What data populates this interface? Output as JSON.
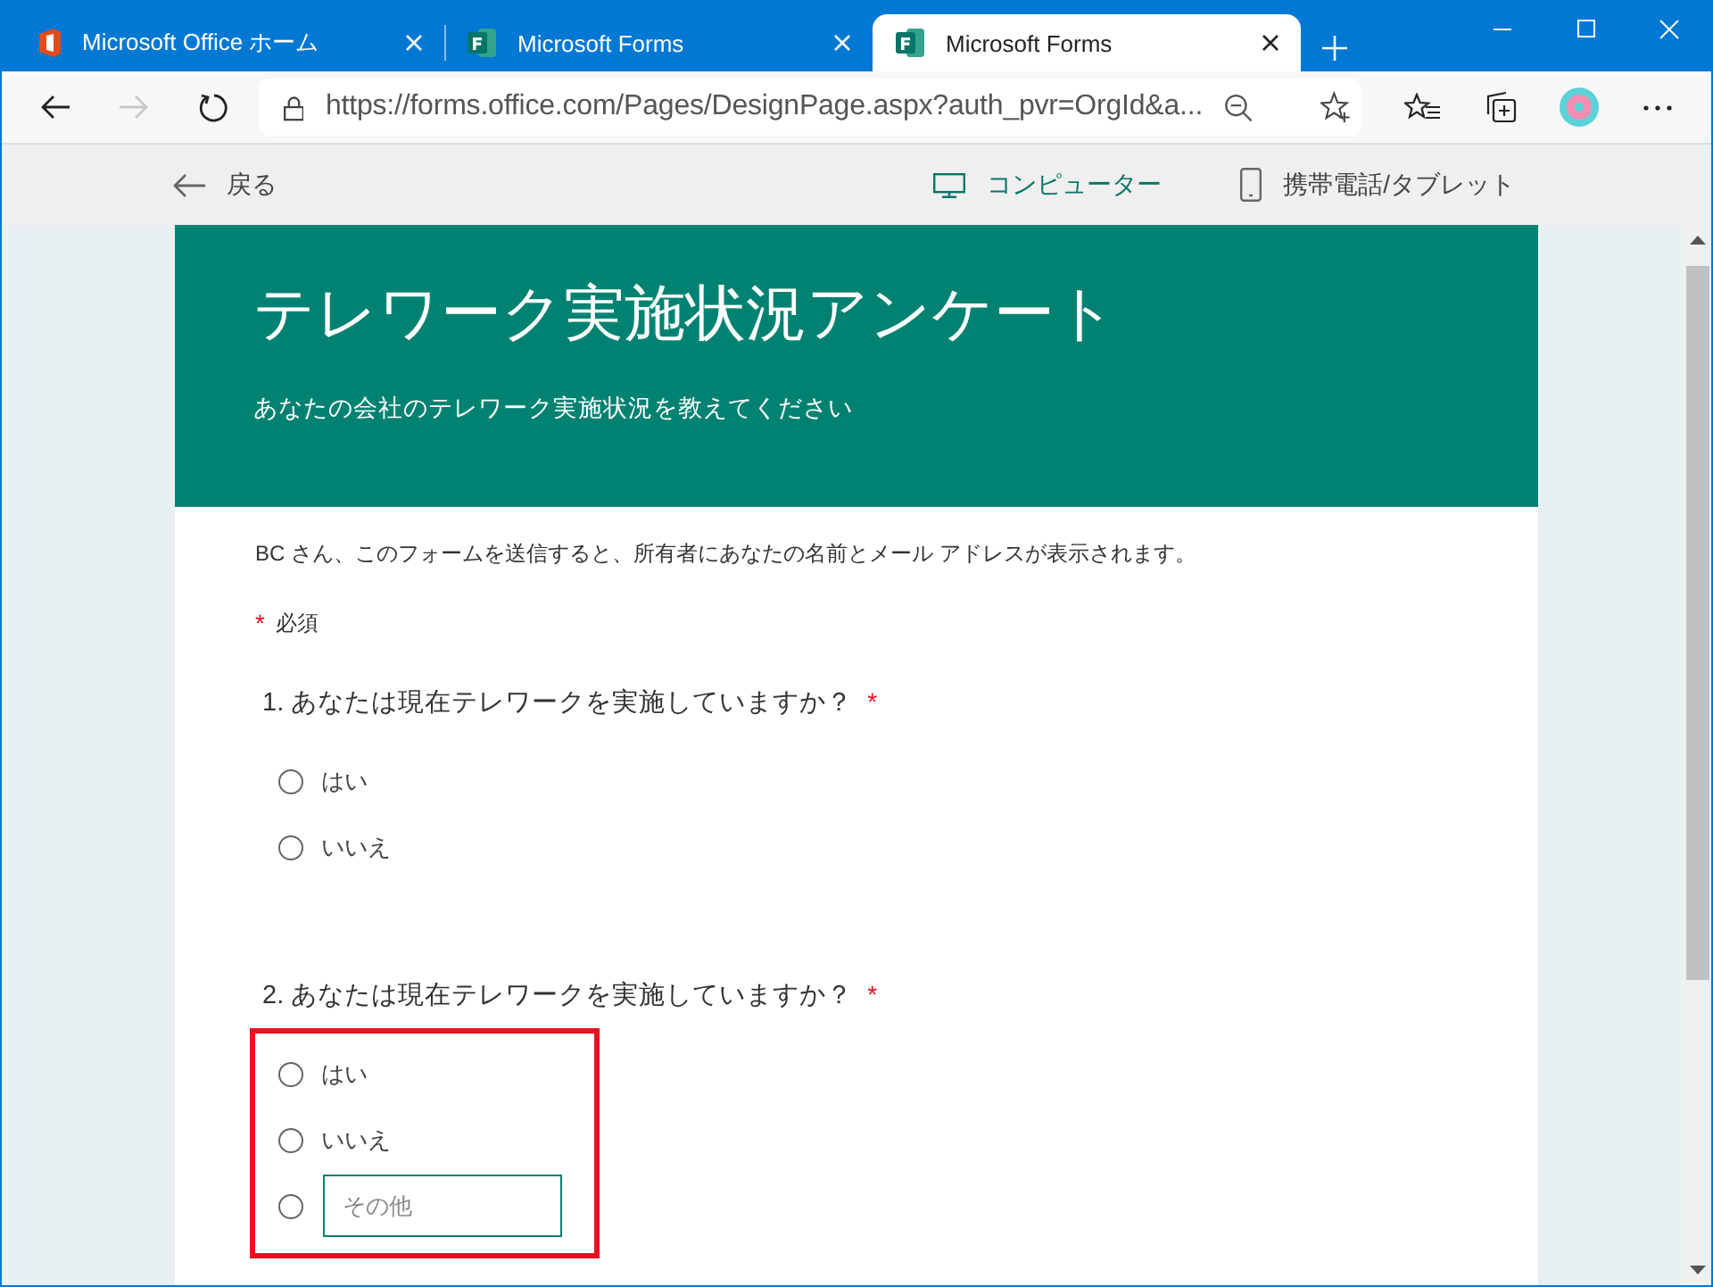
{
  "browser": {
    "tabs": [
      {
        "title": "Microsoft Office ホーム",
        "kind": "office",
        "selected": false
      },
      {
        "title": "Microsoft Forms",
        "kind": "forms",
        "selected": false
      },
      {
        "title": "Microsoft Forms",
        "kind": "forms",
        "selected": true
      }
    ],
    "forward": {
      "disabled": true
    },
    "address": "https://forms.office.com/Pages/DesignPage.aspx?auth_pvr=OrgId&a..."
  },
  "preview_bar": {
    "back": "戻る",
    "modes": [
      {
        "label": "コンピューター",
        "kind": "monitor",
        "selected": true
      },
      {
        "label": "携帯電話/タブレット",
        "kind": "phone",
        "selected": false
      }
    ]
  },
  "form": {
    "title": "テレワーク実施状況アンケート",
    "subtitle": "あなたの会社のテレワーク実施状況を教えてください",
    "notice": "BC さん、このフォームを送信すると、所有者にあなたの名前とメール アドレスが表示されます。",
    "required_legend": {
      "mark": "*",
      "label": "必須"
    },
    "questions": [
      {
        "number": "1.",
        "title": "あなたは現在テレワークを実施していますか？",
        "required": true,
        "highlighted": false,
        "options": [
          {
            "kind": "choice",
            "label": "はい",
            "selected": false
          },
          {
            "kind": "choice",
            "label": "いいえ",
            "selected": false
          }
        ]
      },
      {
        "number": "2.",
        "title": "あなたは現在テレワークを実施していますか？",
        "required": true,
        "highlighted": true,
        "options": [
          {
            "kind": "choice",
            "label": "はい",
            "selected": false
          },
          {
            "kind": "choice",
            "label": "いいえ",
            "selected": false
          },
          {
            "kind": "other",
            "placeholder": "その他",
            "selected": false
          }
        ]
      }
    ]
  }
}
